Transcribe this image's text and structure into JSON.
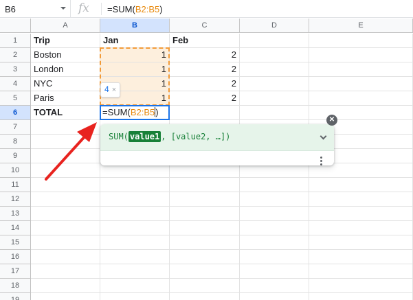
{
  "formula_bar": {
    "cell_ref": "B6",
    "fx_label": "fx",
    "formula_prefix": "=SUM(",
    "formula_range": "B2:B5",
    "formula_suffix": ")"
  },
  "columns": [
    "A",
    "B",
    "C",
    "D",
    "E"
  ],
  "rows": [
    "1",
    "2",
    "3",
    "4",
    "5",
    "6",
    "7",
    "8",
    "9",
    "10",
    "11",
    "12",
    "13",
    "14",
    "15",
    "16",
    "17",
    "18",
    "19"
  ],
  "cells": {
    "A1": "Trip",
    "B1": "Jan",
    "C1": "Feb",
    "A2": "Boston",
    "B2": "1",
    "C2": "2",
    "A3": "London",
    "B3": "1",
    "C3": "2",
    "A4": "NYC",
    "B4": "1",
    "C4": "2",
    "A5": "Paris",
    "B5": "1",
    "C5": "2",
    "A6": "TOTAL"
  },
  "active_cell": {
    "prefix": "=SUM(",
    "range": "B2:B5",
    "suffix": ")"
  },
  "range_chip": {
    "count": "4",
    "close": "×"
  },
  "formula_help": {
    "fn_open": "SUM(",
    "arg_active": "value1",
    "rest": ", [value2, …])"
  },
  "colors": {
    "range_highlight": "#f29a37",
    "help_green": "#188038",
    "annotation_arrow": "#e8231f"
  }
}
